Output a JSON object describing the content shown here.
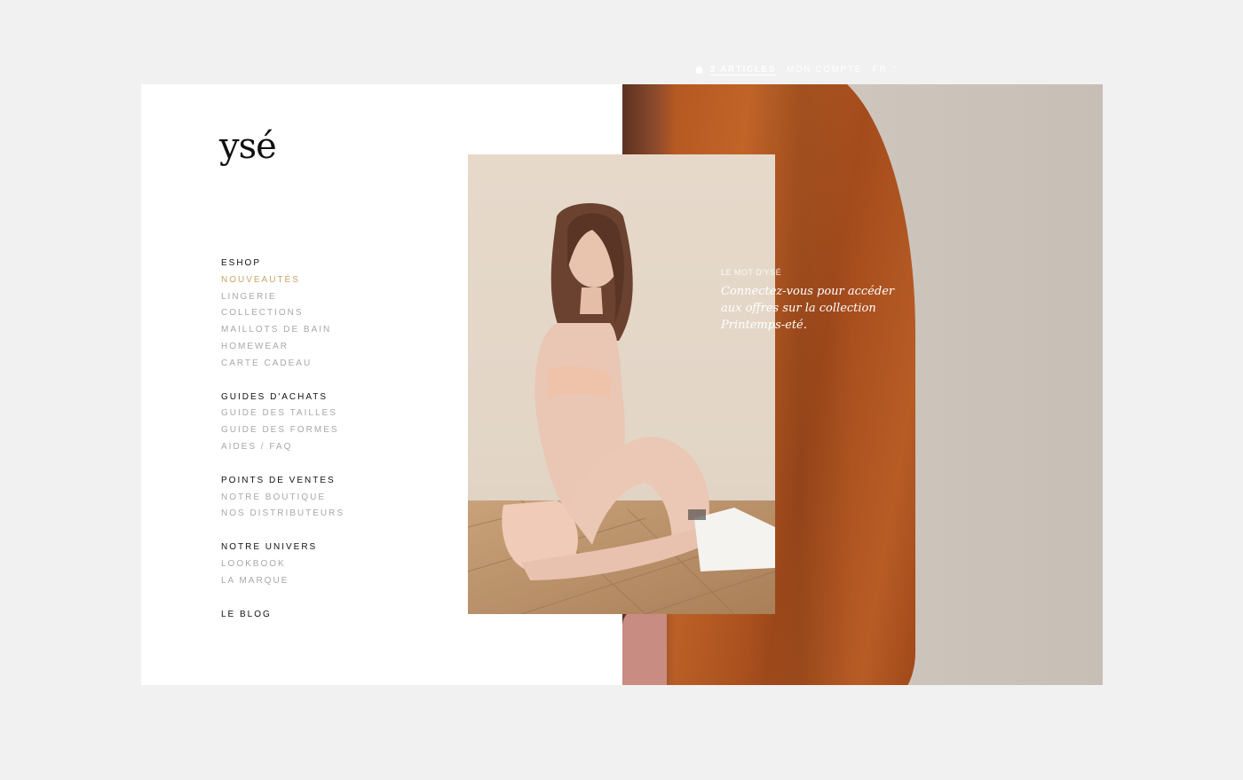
{
  "brand": {
    "logo_text": "ysé"
  },
  "nav": {
    "groups": [
      {
        "heading": "ESHOP",
        "items": [
          "NOUVEAUTÉS",
          "LINGERIE",
          "COLLECTIONS",
          "MAILLOTS DE BAIN",
          "HOMEWEAR",
          "CARTE CADEAU"
        ],
        "active_index": 0
      },
      {
        "heading": "GUIDES D'ACHATS",
        "items": [
          "GUIDE DES TAILLES",
          "GUIDE DES FORMES",
          "AIDES / FAQ"
        ]
      },
      {
        "heading": "POINTS DE VENTES",
        "items": [
          "NOTRE BOUTIQUE",
          "NOS DISTRIBUTEURS"
        ]
      },
      {
        "heading": "NOTRE UNIVERS",
        "items": [
          "LOOKBOOK",
          "LA MARQUE"
        ]
      },
      {
        "heading": "LE BLOG",
        "items": []
      }
    ]
  },
  "header": {
    "cart_icon": "shopping-bag-icon",
    "cart_label": "2 ARTICLES",
    "account_label": "MON COMPTE",
    "language": "FR",
    "language_chevron": "ˇ"
  },
  "quote": {
    "label": "LE MOT D'YSÉ",
    "text": "Connectez-vous pour accéder aux offres sur la collection Printemps-eté."
  },
  "colors": {
    "background": "#f1f1f1",
    "panel": "#ffffff",
    "nav_heading": "#111111",
    "nav_item": "#a8a8a8",
    "nav_active": "#c9a46b",
    "jacket": "#b0531f",
    "header_text": "#ffffff"
  }
}
